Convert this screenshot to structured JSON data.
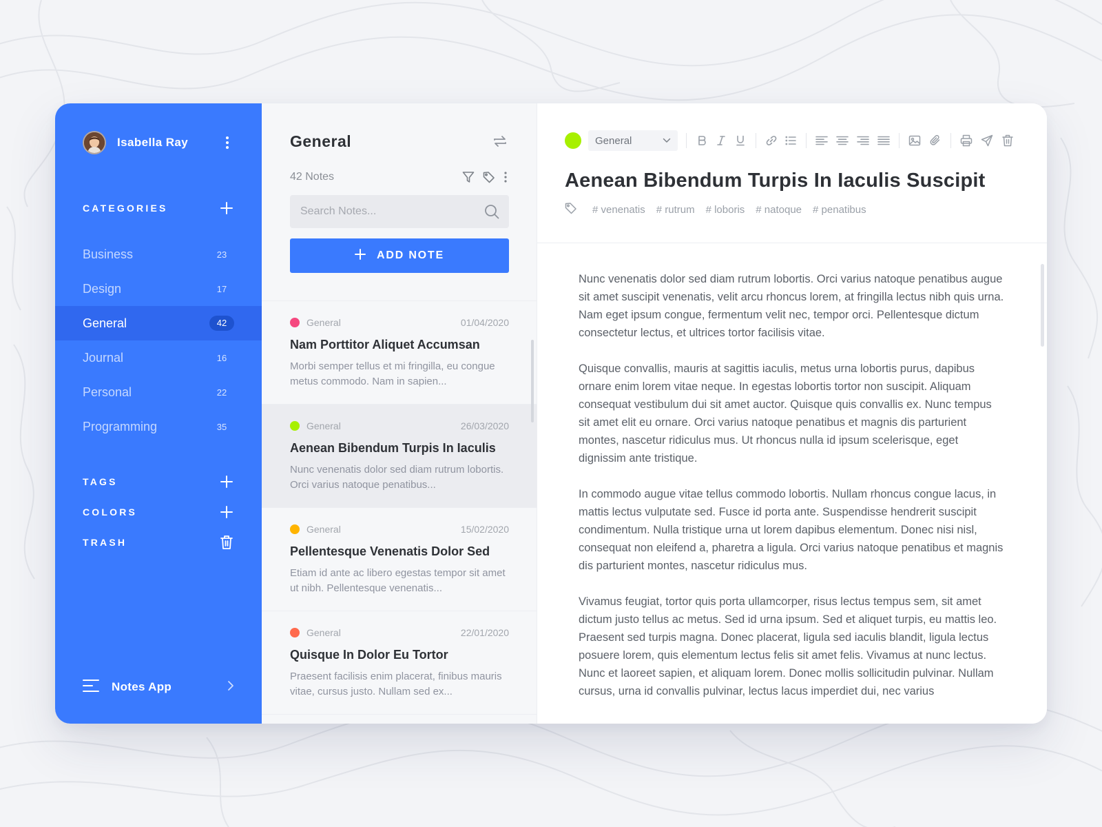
{
  "sidebar": {
    "user_name": "Isabella Ray",
    "categories_title": "CATEGORIES",
    "categories": [
      {
        "label": "Business",
        "count": "23"
      },
      {
        "label": "Design",
        "count": "17"
      },
      {
        "label": "General",
        "count": "42",
        "active": true
      },
      {
        "label": "Journal",
        "count": "16"
      },
      {
        "label": "Personal",
        "count": "22"
      },
      {
        "label": "Programming",
        "count": "35"
      }
    ],
    "tags_title": "TAGS",
    "colors_title": "COLORS",
    "trash_title": "TRASH",
    "footer_label": "Notes App"
  },
  "notelist": {
    "title": "General",
    "count_label": "42 Notes",
    "search_placeholder": "Search Notes...",
    "add_button_label": "ADD NOTE",
    "notes": [
      {
        "category": "General",
        "date": "01/04/2020",
        "title": "Nam Porttitor Aliquet Accumsan",
        "excerpt": "Morbi semper tellus et mi fringilla, eu congue metus commodo. Nam in sapien...",
        "color": "#f5487f"
      },
      {
        "category": "General",
        "date": "26/03/2020",
        "title": "Aenean Bibendum Turpis In Iaculis",
        "excerpt": "Nunc venenatis dolor sed diam rutrum lobortis. Orci varius natoque penatibus...",
        "color": "#a7f000"
      },
      {
        "category": "General",
        "date": "15/02/2020",
        "title": "Pellentesque Venenatis Dolor Sed",
        "excerpt": "Etiam id ante ac libero egestas tempor sit amet ut nibh. Pellentesque venenatis...",
        "color": "#ffb400"
      },
      {
        "category": "General",
        "date": "22/01/2020",
        "title": "Quisque In Dolor Eu Tortor",
        "excerpt": "Praesent facilisis enim placerat, finibus mauris vitae, cursus justo. Nullam sed ex...",
        "color": "#ff6a4d"
      }
    ]
  },
  "editor": {
    "color": "#a7f000",
    "category_value": "General",
    "title": "Aenean Bibendum Turpis In Iaculis Suscipit",
    "tags": [
      "# venenatis",
      "# rutrum",
      "# loboris",
      "# natoque",
      "# penatibus"
    ],
    "paragraphs": [
      "Nunc venenatis dolor sed diam rutrum lobortis. Orci varius natoque penatibus augue sit amet suscipit venenatis, velit arcu rhoncus lorem, at fringilla lectus nibh quis urna. Nam eget ipsum congue, fermentum velit nec, tempor orci. Pellentesque dictum consectetur lectus, et ultrices tortor facilisis vitae.",
      "Quisque convallis, mauris at sagittis iaculis, metus urna lobortis purus, dapibus ornare enim lorem vitae neque. In egestas lobortis tortor non suscipit. Aliquam consequat vestibulum dui sit amet auctor. Quisque quis convallis ex. Nunc tempus sit amet elit eu ornare. Orci varius natoque penatibus et magnis dis parturient montes, nascetur ridiculus mus. Ut rhoncus nulla id ipsum scelerisque, eget dignissim ante tristique.",
      "In commodo augue vitae tellus commodo lobortis. Nullam rhoncus congue lacus, in mattis lectus vulputate sed. Fusce id porta ante. Suspendisse hendrerit suscipit condimentum. Nulla tristique urna ut lorem dapibus elementum. Donec nisi nisl, consequat non eleifend a, pharetra a ligula.  Orci varius natoque penatibus et magnis dis parturient montes, nascetur ridiculus mus.",
      "Vivamus feugiat, tortor quis porta ullamcorper, risus lectus tempus sem, sit amet dictum justo tellus ac metus. Sed id urna ipsum. Sed et aliquet turpis, eu mattis leo. Praesent sed turpis magna. Donec placerat, ligula sed iaculis blandit, ligula lectus posuere lorem, quis elementum lectus felis sit amet felis. Vivamus at nunc lectus. Nunc et laoreet sapien, et aliquam lorem. Donec mollis sollicitudin pulvinar. Nullam cursus, urna id convallis pulvinar, lectus lacus imperdiet dui, nec varius"
    ]
  },
  "icons": {
    "sidebar": [
      "avatar",
      "kebab-icon",
      "plus-icon",
      "trash-icon",
      "menu-icon",
      "chevron-right-icon"
    ],
    "notelist": [
      "sync-icon",
      "filter-icon",
      "tag-icon",
      "kebab-icon",
      "search-icon",
      "plus-icon"
    ],
    "toolbar": [
      "chevron-down-icon",
      "bold-icon",
      "italic-icon",
      "underline-icon",
      "link-icon",
      "list-icon",
      "align-left-icon",
      "align-center-icon",
      "align-right-icon",
      "align-justify-icon",
      "image-icon",
      "attachment-icon",
      "print-icon",
      "send-icon",
      "trash-icon"
    ]
  },
  "colors": {
    "sidebar_bg": "#3a7afe",
    "sidebar_active": "#3068ef",
    "accent": "#3a7afe"
  }
}
